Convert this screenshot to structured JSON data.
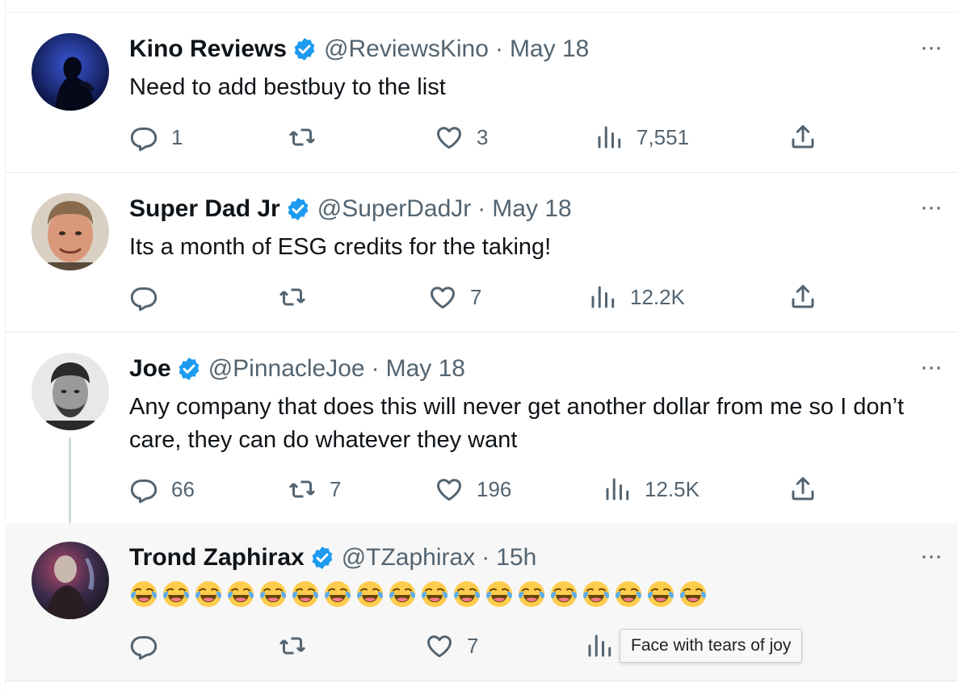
{
  "tweets": [
    {
      "name": "Kino Reviews",
      "handle": "@ReviewsKino",
      "separator": "·",
      "time": "May 18",
      "text": "Need to add bestbuy to the list",
      "replies": "1",
      "retweets": "",
      "likes": "3",
      "views": "7,551"
    },
    {
      "name": "Super Dad Jr",
      "handle": "@SuperDadJr",
      "separator": "·",
      "time": "May 18",
      "text": "Its a month of ESG credits for the taking!",
      "replies": "",
      "retweets": "",
      "likes": "7",
      "views": "12.2K"
    },
    {
      "name": "Joe",
      "handle": "@PinnacleJoe",
      "separator": "·",
      "time": "May 18",
      "text": "Any company that does this will never get another dollar from me so I don’t care, they can do whatever they want",
      "replies": "66",
      "retweets": "7",
      "likes": "196",
      "views": "12.5K"
    },
    {
      "name": "Trond Zaphirax",
      "handle": "@TZaphirax",
      "separator": "·",
      "time": "15h",
      "emoji_icon": "face-with-tears-of-joy",
      "emoji_count": 18,
      "replies": "",
      "retweets": "",
      "likes": "7",
      "views": ""
    }
  ],
  "more_label": "···",
  "tooltip": "Face with tears of joy",
  "colors": {
    "text": "#0f1419",
    "secondary": "#536471",
    "verified": "#1d9bf0",
    "highlight_bg": "#f7f7f7"
  },
  "icons": [
    "reply-icon",
    "retweet-icon",
    "like-icon",
    "views-icon",
    "share-icon",
    "verified-badge-icon",
    "more-icon"
  ]
}
